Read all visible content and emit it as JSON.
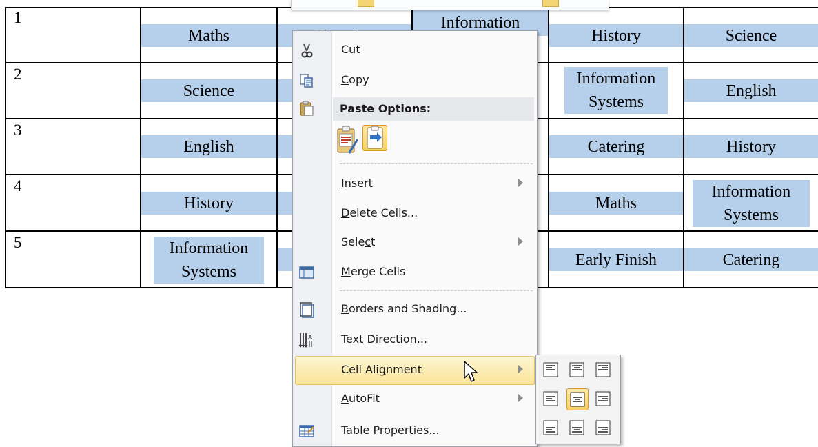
{
  "timetable": {
    "rows": [
      {
        "day": "1",
        "cells": [
          "Maths",
          "Catering",
          "Information",
          "History",
          "Science"
        ]
      },
      {
        "day": "2",
        "cells": [
          "Science",
          "",
          "",
          "Information Systems",
          "English"
        ]
      },
      {
        "day": "3",
        "cells": [
          "English",
          "",
          "",
          "Catering",
          "History"
        ]
      },
      {
        "day": "4",
        "cells": [
          "History",
          "",
          "",
          "Maths",
          "Information Systems"
        ]
      },
      {
        "day": "5",
        "cells": [
          "Information Systems",
          "",
          "",
          "Early Finish",
          "Catering"
        ]
      }
    ],
    "highlight_color": "#b6d0eb"
  },
  "context_menu": {
    "items": {
      "cut": {
        "label_pre": "Cu",
        "label_key": "t",
        "label_post": "",
        "icon": "scissors-icon"
      },
      "copy": {
        "label_pre": "",
        "label_key": "C",
        "label_post": "opy",
        "icon": "copy-icon"
      },
      "paste_options": {
        "label": "Paste Options:",
        "icon": "clipboard-icon"
      },
      "insert": {
        "label_pre": "",
        "label_key": "I",
        "label_post": "nsert"
      },
      "delete_cells": {
        "label_pre": "",
        "label_key": "D",
        "label_post": "elete Cells..."
      },
      "select": {
        "label_pre": "Sele",
        "label_key": "c",
        "label_post": "t"
      },
      "merge_cells": {
        "label_pre": "",
        "label_key": "M",
        "label_post": "erge Cells",
        "icon": "merge-cells-icon"
      },
      "borders_shading": {
        "label_pre": "",
        "label_key": "B",
        "label_post": "orders and Shading...",
        "icon": "borders-icon"
      },
      "text_direction": {
        "label_pre": "Te",
        "label_key": "x",
        "label_post": "t Direction...",
        "icon": "text-direction-icon"
      },
      "cell_alignment": {
        "label_pre": "Cell Ali",
        "label_key": "g",
        "label_post": "nment"
      },
      "autofit": {
        "label_pre": "",
        "label_key": "A",
        "label_post": "utoFit"
      },
      "table_properties": {
        "label_pre": "Table P",
        "label_key": "r",
        "label_post": "operties...",
        "icon": "table-properties-icon"
      }
    },
    "highlighted_item": "Cell Alignment",
    "highlight_color": "#fbe497"
  },
  "alignment_palette": {
    "selected": "middle-center",
    "buttons": [
      "top-left",
      "top-center",
      "top-right",
      "middle-left",
      "middle-center",
      "middle-right",
      "bottom-left",
      "bottom-center",
      "bottom-right"
    ]
  }
}
